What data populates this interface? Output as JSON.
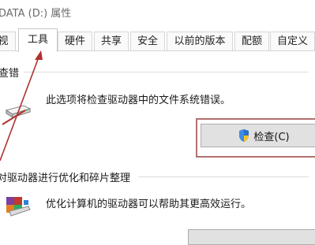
{
  "window": {
    "title": "DATA (D:) 属性"
  },
  "tabs": [
    {
      "label": "视"
    },
    {
      "label": "工具"
    },
    {
      "label": "硬件"
    },
    {
      "label": "共享"
    },
    {
      "label": "安全"
    },
    {
      "label": "以前的版本"
    },
    {
      "label": "配额"
    },
    {
      "label": "自定义"
    }
  ],
  "error_check": {
    "title": "查错",
    "description": "此选项将检查驱动器中的文件系统错误。",
    "button_label": "检查(C)",
    "button_icon": "uac-shield-icon"
  },
  "optimize": {
    "title": "对驱动器进行优化和碎片整理",
    "description": "优化计算机的驱动器可以帮助其更高效运行。",
    "icon": "defrag-icon"
  },
  "colors": {
    "annotation_red": "#b03030",
    "highlight_border": "#b07070",
    "button_face": "#e1e1e1"
  }
}
